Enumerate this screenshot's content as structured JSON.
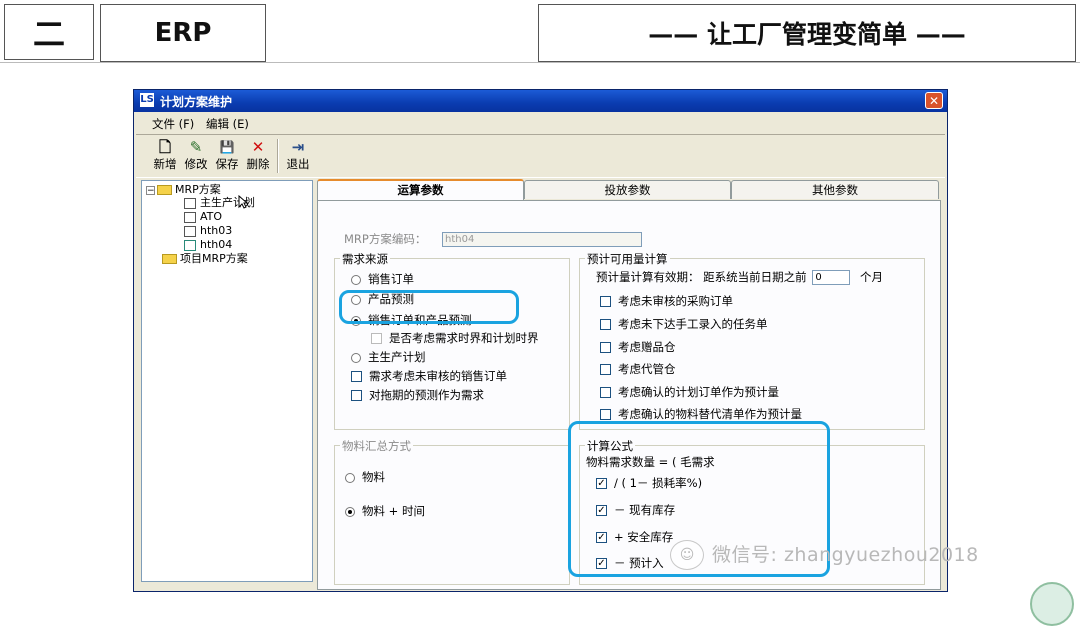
{
  "slide": {
    "number": "二",
    "topic": "ERP",
    "subtitle": "—— 让工厂管理变简单 ——"
  },
  "window": {
    "app_icon_text": "LS",
    "title": "计划方案维护",
    "close_glyph": "✕",
    "menu": [
      "文件 (F)",
      "编辑 (E)"
    ],
    "toolbar": [
      {
        "label": "新增",
        "icon": "new-document-icon",
        "glyph": "🗋"
      },
      {
        "label": "修改",
        "icon": "edit-icon",
        "glyph": "✎"
      },
      {
        "label": "保存",
        "icon": "save-icon",
        "glyph": "💾"
      },
      {
        "label": "删除",
        "icon": "delete-icon",
        "glyph": "✕"
      },
      {
        "label": "退出",
        "icon": "exit-icon",
        "glyph": "⇥"
      }
    ]
  },
  "tree": {
    "root": "MRP方案",
    "children": [
      "主生产计划",
      "ATO",
      "hth03",
      "hth04"
    ],
    "second_root": "项目MRP方案",
    "expander": "−"
  },
  "tabs": [
    "运算参数",
    "投放参数",
    "其他参数"
  ],
  "form": {
    "plan_code_label": "MRP方案编码：",
    "plan_code_value": "hth04",
    "demand_source": {
      "caption": "需求来源",
      "options": [
        "销售订单",
        "产品预测",
        "销售订单和产品预测"
      ],
      "selected_option": "销售订单和产品预测",
      "sub_checkbox": "是否考虑需求时界和计划时界",
      "mps_option": "主生产计划",
      "checkboxes": [
        "需求考虑未审核的销售订单",
        "对拖期的预测作为需求"
      ]
    },
    "available": {
      "caption": "预计可用量计算",
      "validity_label": "预计量计算有效期：  距系统当前日期之前",
      "validity_value": "0",
      "validity_unit": "个月",
      "checkboxes": [
        "考虑未审核的采购订单",
        "考虑未下达手工录入的任务单",
        "考虑赠品仓",
        "考虑代管仓",
        "考虑确认的计划订单作为预计量",
        "考虑确认的物料替代清单作为预计量"
      ]
    },
    "material_summary": {
      "caption": "物料汇总方式",
      "options": [
        "物料",
        "物料 + 时间"
      ],
      "selected_option": "物料 + 时间"
    },
    "formula": {
      "caption": "计算公式",
      "header": "物料需求数量 = ( 毛需求",
      "terms": [
        "/ ( 1－  损耗率%)",
        "－  现有库存",
        "+   安全库存",
        "－ 预计入"
      ],
      "checked": [
        "✓",
        "✓",
        "✓",
        "✓"
      ]
    }
  },
  "watermark": {
    "text": "微信号: zhangyuezhou2018",
    "icon_glyph": "☺"
  },
  "colors": {
    "highlight": "#1aa3e0",
    "titlebar": "#0a3cb0",
    "window_bg": "#ece9d8"
  }
}
